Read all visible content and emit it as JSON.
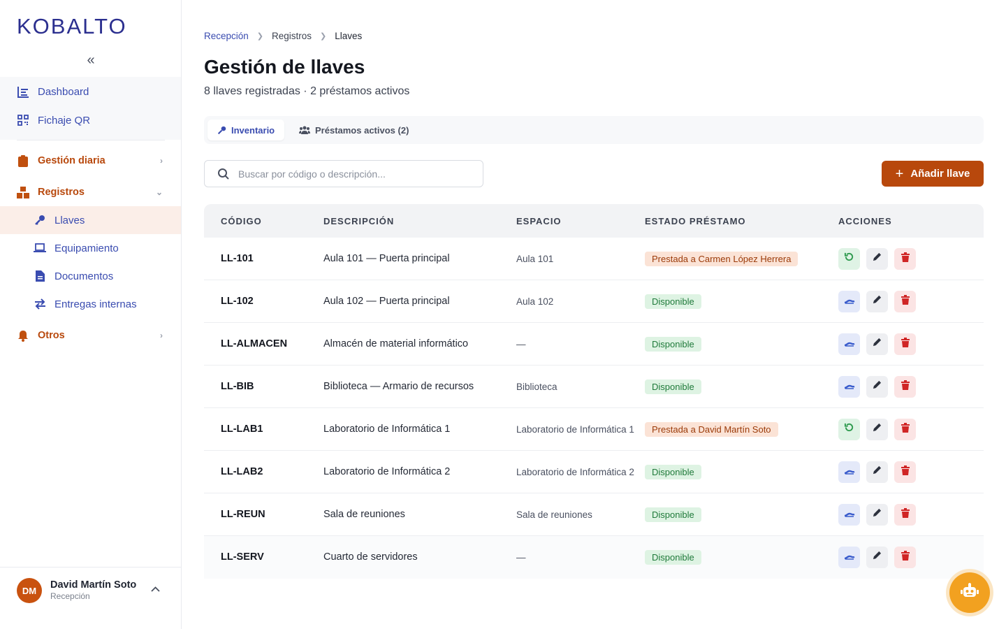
{
  "brand": {
    "logo": "KOBALTO"
  },
  "sidebar": {
    "collapse_glyph": "«",
    "items": [
      {
        "label": "Dashboard",
        "icon": "dashboard-icon"
      },
      {
        "label": "Fichaje QR",
        "icon": "qr-code-icon"
      },
      {
        "label": "Gestión diaria",
        "icon": "clipboard-icon"
      },
      {
        "label": "Registros",
        "icon": "boxes-icon"
      },
      {
        "label": "Llaves",
        "icon": "key-icon"
      },
      {
        "label": "Equipamiento",
        "icon": "laptop-icon"
      },
      {
        "label": "Documentos",
        "icon": "document-icon"
      },
      {
        "label": "Entregas internas",
        "icon": "exchange-icon"
      },
      {
        "label": "Otros",
        "icon": "bell-icon"
      }
    ]
  },
  "user": {
    "initials": "DM",
    "name": "David Martín Soto",
    "role": "Recepción"
  },
  "breadcrumb": [
    "Recepción",
    "Registros",
    "Llaves"
  ],
  "page": {
    "title": "Gestión de llaves",
    "subtitle": "8 llaves registradas · 2 préstamos activos"
  },
  "tabs": [
    {
      "label": "Inventario",
      "active": true
    },
    {
      "label": "Préstamos activos (2)",
      "active": false
    }
  ],
  "search": {
    "placeholder": "Buscar por código o descripción...",
    "value": ""
  },
  "add_button": {
    "label": "Añadir llave"
  },
  "table": {
    "headers": [
      "CÓDIGO",
      "DESCRIPCIÓN",
      "ESPACIO",
      "ESTADO PRÉSTAMO",
      "ACCIONES"
    ],
    "rows": [
      {
        "code": "LL-101",
        "description": "Aula 101 — Puerta principal",
        "space": "Aula 101",
        "status": "Prestada a Carmen López Herrera",
        "loaned": true
      },
      {
        "code": "LL-102",
        "description": "Aula 102 — Puerta principal",
        "space": "Aula 102",
        "status": "Disponible",
        "loaned": false
      },
      {
        "code": "LL-ALMACEN",
        "description": "Almacén de material informático",
        "space": "—",
        "status": "Disponible",
        "loaned": false
      },
      {
        "code": "LL-BIB",
        "description": "Biblioteca — Armario de recursos",
        "space": "Biblioteca",
        "status": "Disponible",
        "loaned": false
      },
      {
        "code": "LL-LAB1",
        "description": "Laboratorio de Informática 1",
        "space": "Laboratorio de Informática 1",
        "status": "Prestada a David Martín Soto",
        "loaned": true
      },
      {
        "code": "LL-LAB2",
        "description": "Laboratorio de Informática 2",
        "space": "Laboratorio de Informática 2",
        "status": "Disponible",
        "loaned": false
      },
      {
        "code": "LL-REUN",
        "description": "Sala de reuniones",
        "space": "Sala de reuniones",
        "status": "Disponible",
        "loaned": false
      },
      {
        "code": "LL-SERV",
        "description": "Cuarto de servidores",
        "space": "—",
        "status": "Disponible",
        "loaned": false
      }
    ]
  },
  "colors": {
    "accent": "#b8480c",
    "primary": "#3a4cb0",
    "fab": "#f2a120",
    "loaned_badge_bg": "#fbe3d6",
    "available_badge_bg": "#def3e3"
  },
  "fab": {
    "icon": "robot-icon"
  }
}
